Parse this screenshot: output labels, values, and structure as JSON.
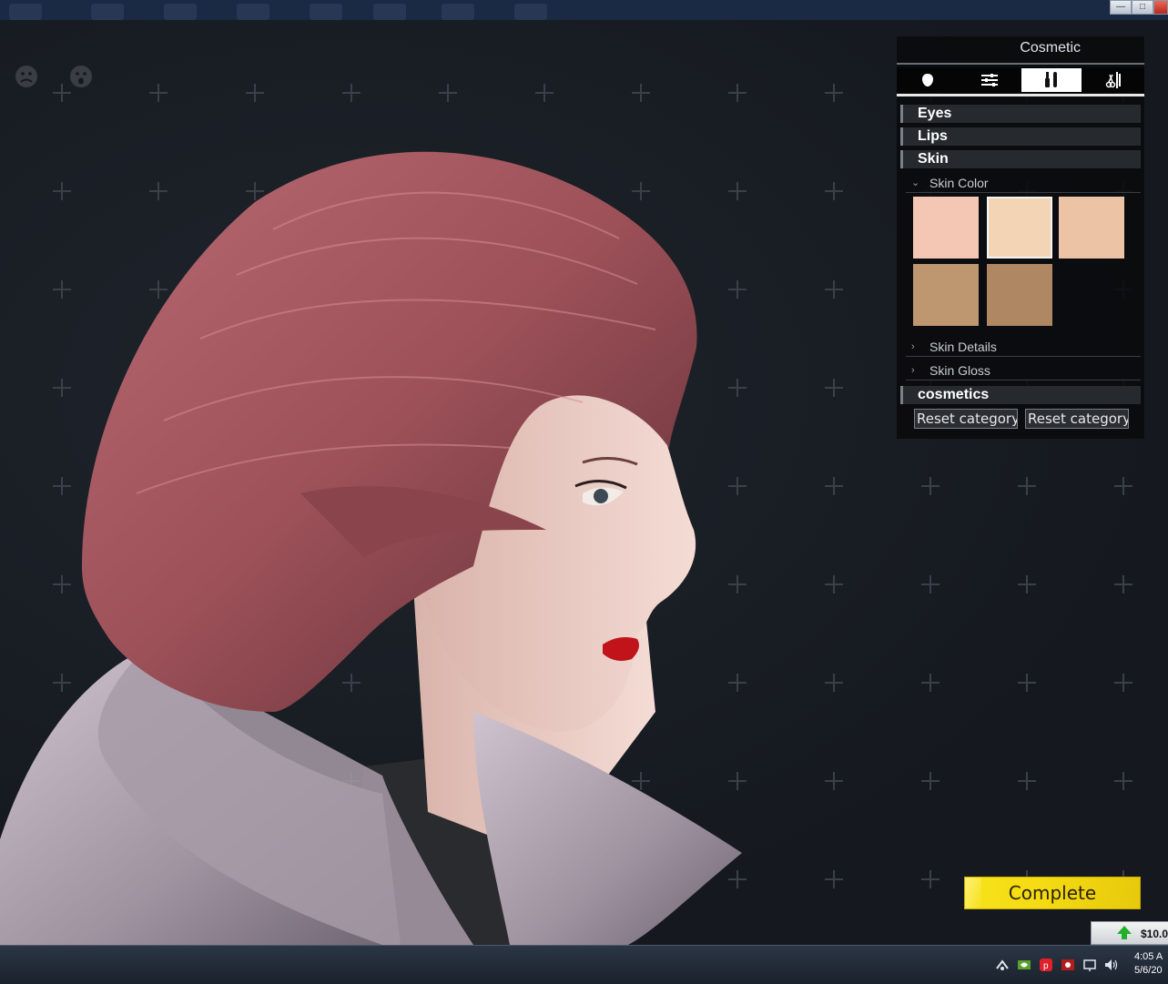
{
  "panel": {
    "title": "Cosmetic",
    "tabs": [
      {
        "name": "face-icon"
      },
      {
        "name": "sliders-icon"
      },
      {
        "name": "makeup-tools-icon",
        "active": true
      },
      {
        "name": "hairstyle-tools-icon"
      }
    ],
    "categories": {
      "eyes": "Eyes",
      "lips": "Lips",
      "skin": "Skin",
      "cosmetics": "cosmetics"
    },
    "skin_color_label": "Skin Color",
    "skin_details_label": "Skin Details",
    "skin_gloss_label": "Skin Gloss",
    "swatches": [
      "#f3c7b3",
      "#f3d4b4",
      "#ecc3a5",
      "#be9670",
      "#af8763"
    ],
    "selected_swatch": 1,
    "reset_buttons": [
      "Reset category",
      "Reset category"
    ]
  },
  "complete_label": "Complete",
  "price": "$10.0",
  "clock": {
    "time": "4:05 A",
    "date": "5/6/20"
  },
  "colors": {
    "accent": "#f5dc14",
    "hair": "#a05860",
    "lips": "#c0141a",
    "jacket": "#b6a9b6"
  }
}
